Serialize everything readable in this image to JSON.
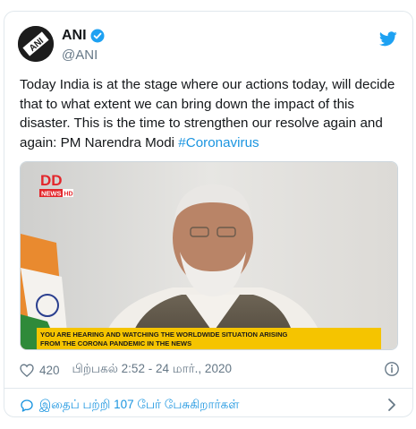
{
  "author": {
    "name": "ANI",
    "handle": "@ANI",
    "avatar_text": "ANI"
  },
  "tweet": {
    "text": "Today India is at the stage where our actions today, will decide that to what extent we can bring down the impact of this disaster. This is the time to strengthen our resolve again and again: PM Narendra Modi ",
    "hashtag": "#Coronavirus"
  },
  "media": {
    "channel_logo": "DD",
    "channel_sub": "NEWS",
    "channel_sub_hd": "HD",
    "ticker_line1": "YOU ARE HEARING AND WATCHING THE WORLDWIDE SITUATION ARISING",
    "ticker_line2": "FROM THE CORONA PANDEMIC IN THE NEWS"
  },
  "meta": {
    "likes": "420",
    "timestamp": "பிற்பகல் 2:52 - 24 மார்., 2020"
  },
  "reply": {
    "label": "இதைப் பற்றி 107 பேர் பேசுகிறார்கள்"
  },
  "colors": {
    "verified": "#1da1f2",
    "link": "#1b95e0",
    "ticker": "#f5c400"
  },
  "icons": [
    "verified-badge-icon",
    "twitter-bird-icon",
    "heart-icon",
    "info-icon",
    "speech-bubble-icon",
    "chevron-right-icon"
  ]
}
